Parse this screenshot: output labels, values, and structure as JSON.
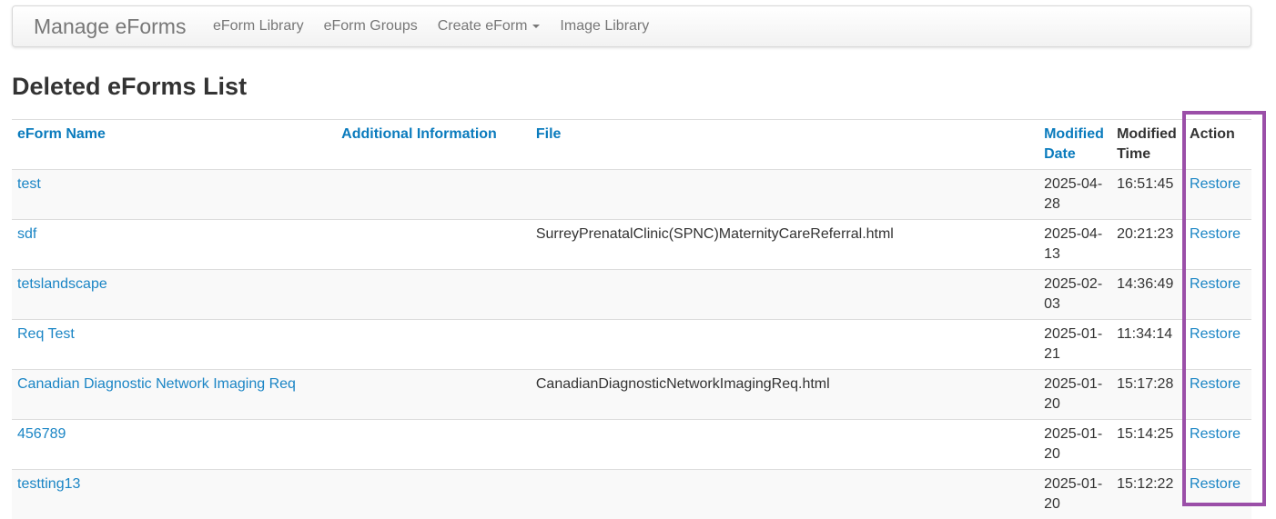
{
  "navbar": {
    "brand": "Manage eForms",
    "items": [
      {
        "label": "eForm Library"
      },
      {
        "label": "eForm Groups"
      },
      {
        "label": "Create eForm"
      },
      {
        "label": "Image Library"
      }
    ]
  },
  "page_title": "Deleted eForms List",
  "table": {
    "headers": {
      "name": "eForm Name",
      "info": "Additional Information",
      "file": "File",
      "mdate_1": "Modified",
      "mdate_2": "Date",
      "mtime_1": "Modified",
      "mtime_2": "Time",
      "action": "Action"
    },
    "rows": [
      {
        "name": "test",
        "info": "",
        "file": "",
        "date_1": "2025-04-",
        "date_2": "28",
        "time": "16:51:45",
        "action": "Restore"
      },
      {
        "name": "sdf",
        "info": "",
        "file": "SurreyPrenatalClinic(SPNC)MaternityCareReferral.html",
        "date_1": "2025-04-",
        "date_2": "13",
        "time": "20:21:23",
        "action": "Restore"
      },
      {
        "name": "tetslandscape",
        "info": "",
        "file": "",
        "date_1": "2025-02-",
        "date_2": "03",
        "time": "14:36:49",
        "action": "Restore"
      },
      {
        "name": "Req Test",
        "info": "",
        "file": "",
        "date_1": "2025-01-",
        "date_2": "21",
        "time": "11:34:14",
        "action": "Restore"
      },
      {
        "name": "Canadian Diagnostic Network Imaging Req",
        "info": "",
        "file": "CanadianDiagnosticNetworkImagingReq.html",
        "date_1": "2025-01-",
        "date_2": "20",
        "time": "15:17:28",
        "action": "Restore"
      },
      {
        "name": "456789",
        "info": "",
        "file": "",
        "date_1": "2025-01-",
        "date_2": "20",
        "time": "15:14:25",
        "action": "Restore"
      },
      {
        "name": "testting13",
        "info": "",
        "file": "",
        "date_1": "2025-01-",
        "date_2": "20",
        "time": "15:12:22",
        "action": "Restore"
      }
    ]
  },
  "colors": {
    "link": "#1a85c5",
    "highlight": "#9b4fa8"
  }
}
